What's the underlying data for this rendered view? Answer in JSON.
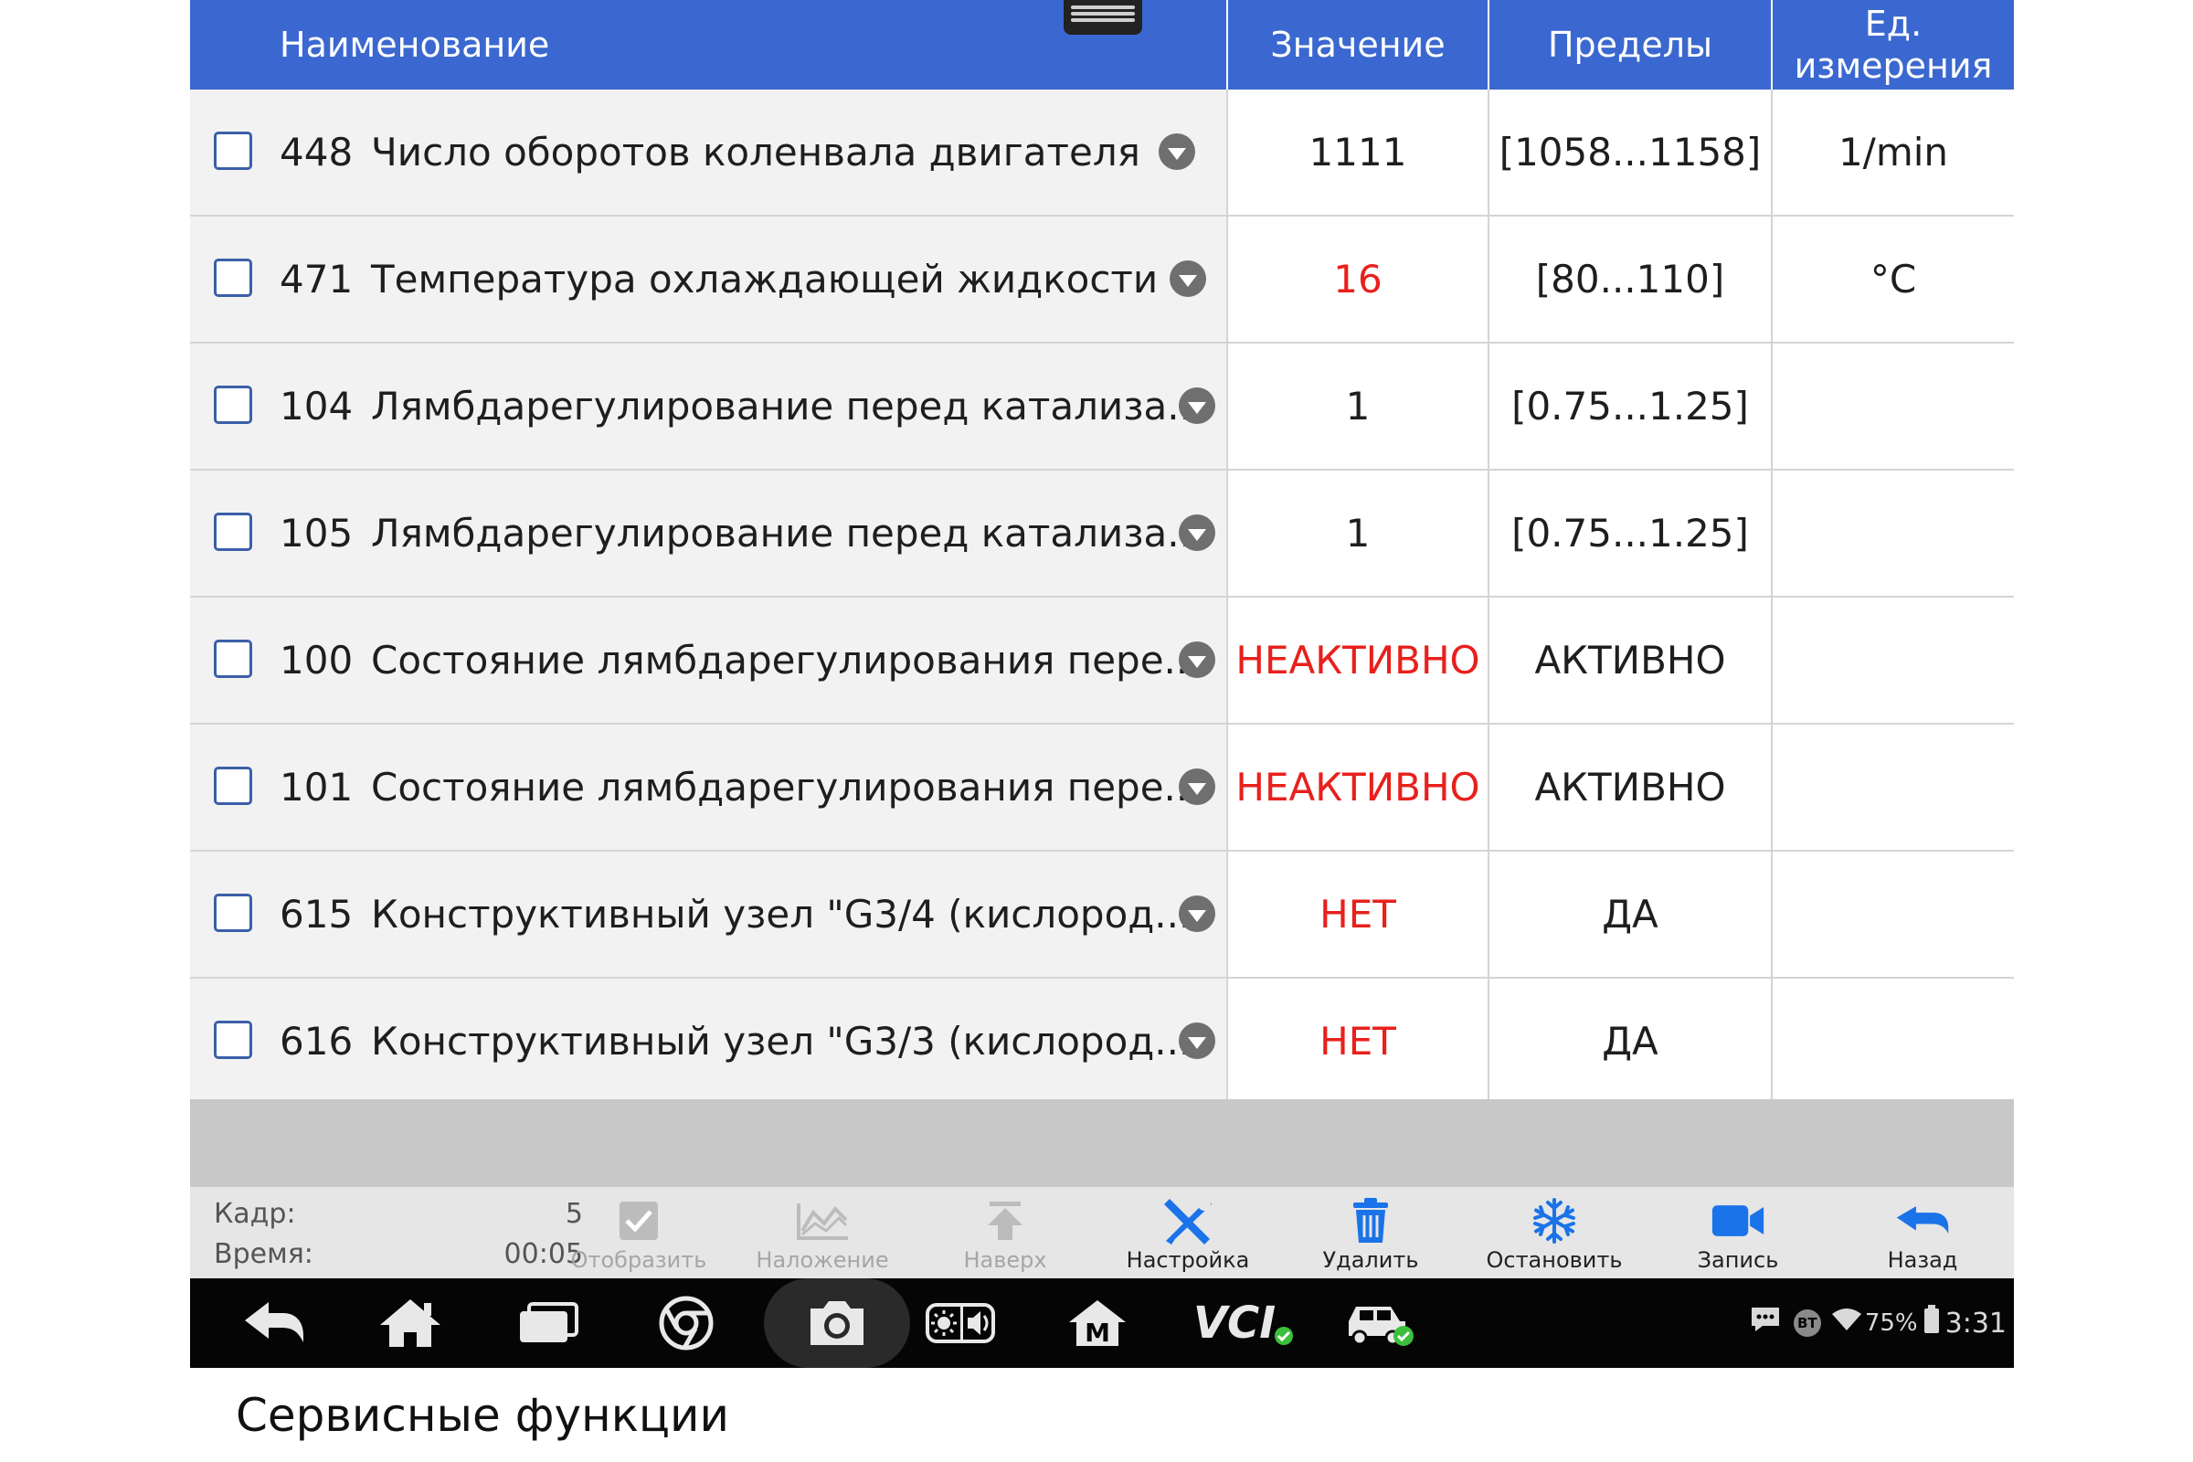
{
  "header": {
    "name_col": "Наименование",
    "value_col": "Значение",
    "limits_col": "Пределы",
    "unit_col_line1": "Ед.",
    "unit_col_line2": "измерения"
  },
  "rows": [
    {
      "id": "448",
      "label": "Число оборотов коленвала двигателя",
      "value": "1111",
      "limits": "[1058...1158]",
      "unit": "1/min",
      "value_alert": false
    },
    {
      "id": "471",
      "label": "Температура охлаждающей жидкости",
      "value": "16",
      "limits": "[80...110]",
      "unit": "°C",
      "value_alert": true
    },
    {
      "id": "104",
      "label": "Лямбдарегулирование перед катализа...",
      "value": "1",
      "limits": "[0.75...1.25]",
      "unit": "",
      "value_alert": false
    },
    {
      "id": "105",
      "label": "Лямбдарегулирование перед катализа...",
      "value": "1",
      "limits": "[0.75...1.25]",
      "unit": "",
      "value_alert": false
    },
    {
      "id": "100",
      "label": "Состояние лямбдарегулирования пере...",
      "value": "НЕАКТИВНО",
      "limits": "АКТИВНО",
      "unit": "",
      "value_alert": true
    },
    {
      "id": "101",
      "label": "Состояние лямбдарегулирования пере...",
      "value": "НЕАКТИВНО",
      "limits": "АКТИВНО",
      "unit": "",
      "value_alert": true
    },
    {
      "id": "615",
      "label": "Конструктивный узел \"G3/4 (кислород...",
      "value": "НЕТ",
      "limits": "ДА",
      "unit": "",
      "value_alert": true
    },
    {
      "id": "616",
      "label": "Конструктивный узел \"G3/3 (кислород...",
      "value": "НЕТ",
      "limits": "ДА",
      "unit": "",
      "value_alert": true
    }
  ],
  "toolbar": {
    "frame_label": "Кадр:",
    "frame_value": "5",
    "time_label": "Время:",
    "time_value": "00:05",
    "buttons": [
      {
        "label": "Отобразить",
        "icon": "checkbox-icon",
        "enabled": false
      },
      {
        "label": "Наложение",
        "icon": "graph-icon",
        "enabled": false
      },
      {
        "label": "Наверх",
        "icon": "arrow-up-icon",
        "enabled": false
      },
      {
        "label": "Настройка",
        "icon": "tools-icon",
        "enabled": true
      },
      {
        "label": "Удалить",
        "icon": "trash-icon",
        "enabled": true
      },
      {
        "label": "Остановить",
        "icon": "snowflake-icon",
        "enabled": true
      },
      {
        "label": "Запись",
        "icon": "video-camera-icon",
        "enabled": true
      },
      {
        "label": "Назад",
        "icon": "back-arrow-icon",
        "enabled": true
      }
    ]
  },
  "navbar": {
    "vci_label": "VCI",
    "m_label": "M",
    "battery": "75%",
    "time": "3:31",
    "bt_label": "BT"
  },
  "caption": "Сервисные функции",
  "colors": {
    "header_bg": "#3b68d0",
    "alert_text": "#e8201c",
    "toolbar_accent": "#1a73e8"
  }
}
